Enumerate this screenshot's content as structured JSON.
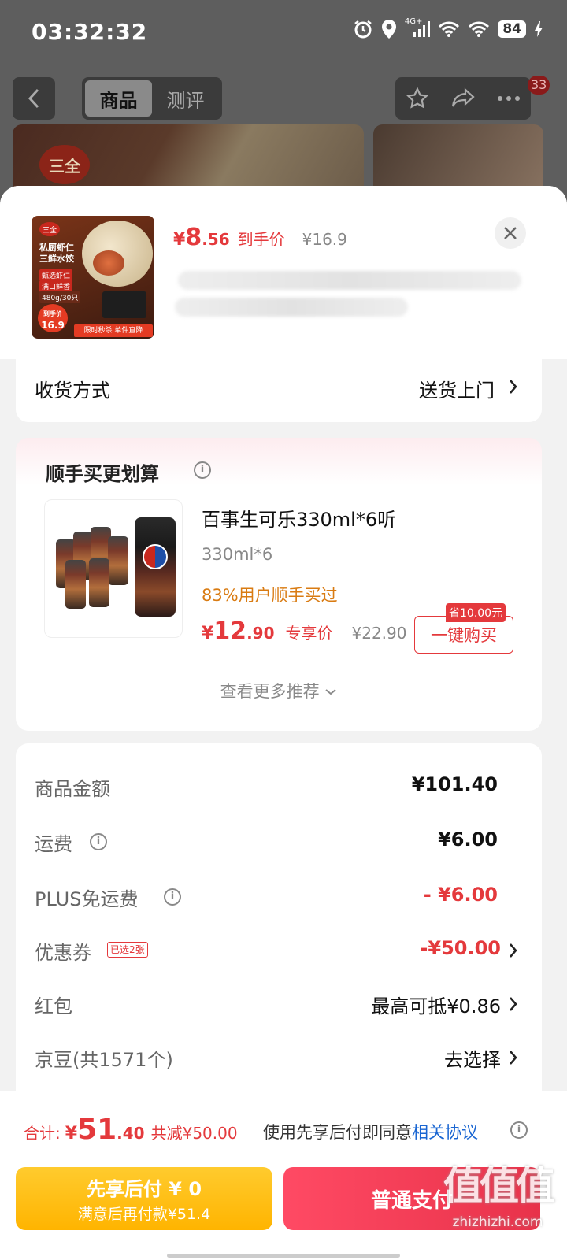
{
  "status_bar": {
    "time": "03:32:32",
    "network": "4G+",
    "battery": "84"
  },
  "nav": {
    "tabs": [
      "商品",
      "测评"
    ],
    "active_tab": 0,
    "badge": "33"
  },
  "background": {
    "logo_text": "三全"
  },
  "product": {
    "thumb": {
      "logo": "三全",
      "title_line1": "私厨虾仁",
      "title_line2": "三鲜水饺",
      "tag1": "甄选虾仁",
      "tag2": "满口鲜香",
      "tag3": "480g/30只",
      "price_badge_line1": "到手价",
      "price_badge_line2": "16.9",
      "promo": "限时秒杀 单件直降"
    },
    "price_currency": "¥",
    "price_int": "8",
    "price_dec": ".56",
    "price_label": "到手价",
    "original_price": "¥16.9"
  },
  "delivery": {
    "label": "收货方式",
    "value": "送货上门"
  },
  "recommend": {
    "title": "顺手买更划算",
    "item": {
      "name": "百事生可乐330ml*6听",
      "spec": "330ml*6",
      "buyers": "83%用户顺手买过",
      "price_currency": "¥",
      "price_int": "12",
      "price_dec": ".90",
      "price_tag": "专享价",
      "original_price": "¥22.90",
      "save_badge": "省10.00元",
      "buy_label": "一键购买"
    },
    "more_label": "查看更多推荐"
  },
  "summary": {
    "goods_label": "商品金额",
    "goods_value": "¥101.40",
    "shipping_label": "运费",
    "shipping_value": "¥6.00",
    "plus_label": "PLUS免运费",
    "plus_value": "- ¥6.00",
    "coupon_label": "优惠券",
    "coupon_chip": "已选2张",
    "coupon_value": "-¥50.00",
    "redpacket_label": "红包",
    "redpacket_value": "最高可抵¥0.86",
    "jd_beans_label": "京豆(共1571个)",
    "jd_beans_value": "去选择"
  },
  "footer": {
    "total_label": "合计:",
    "total_currency": "¥",
    "total_int": "51",
    "total_dec": ".40",
    "total_saved": "共减¥50.00",
    "agree_text": "使用先享后付即同意",
    "agree_link": "相关协议",
    "pay_later_line1": "先享后付 ¥ 0",
    "pay_later_line2": "满意后再付款¥51.4",
    "pay_normal": "普通支付"
  },
  "watermark": {
    "logo": "值值值",
    "url": "zhizhizhi.com"
  },
  "colors": {
    "accent_red": "#e4393c",
    "pay_later_yellow": "#ffb400",
    "link_blue": "#1a66d2",
    "buyers_orange": "#d97b12"
  }
}
